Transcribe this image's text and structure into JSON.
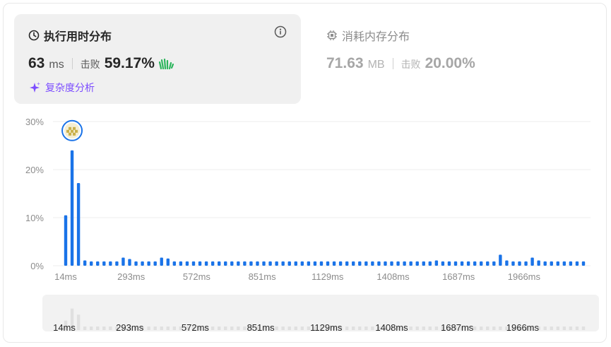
{
  "runtime": {
    "title": "执行用时分布",
    "value": "63",
    "unit": "ms",
    "beat_label": "击败",
    "beat_value": "59.17%",
    "complexity_label": "复杂度分析"
  },
  "memory": {
    "title": "消耗内存分布",
    "value": "71.63",
    "unit": "MB",
    "beat_label": "击败",
    "beat_value": "20.00%"
  },
  "colors": {
    "bar": "#1a73e8",
    "accent_purple": "#7c4dff",
    "clap_green": "#2db55d",
    "marker_ring": "#1a73e8",
    "minimap_bar": "#e0e0e0"
  },
  "icons": {
    "runtime": "clock-icon",
    "memory": "chip-icon",
    "info": "info-icon",
    "complexity": "sparkle-icon",
    "beat": "clap-hands-icon",
    "marker": "user-avatar-icon"
  },
  "chart_data": {
    "type": "bar",
    "ylabel": "",
    "xlabel": "",
    "ylim": [
      0,
      30
    ],
    "y_ticks": [
      "0%",
      "10%",
      "20%",
      "30%"
    ],
    "x_tick_labels": [
      "14ms",
      "293ms",
      "572ms",
      "851ms",
      "1129ms",
      "1408ms",
      "1687ms",
      "1966ms"
    ],
    "values": [
      10.5,
      24.0,
      17.2,
      1.1,
      0.9,
      0.9,
      0.9,
      0.9,
      0.9,
      1.7,
      1.4,
      0.9,
      0.9,
      0.9,
      0.9,
      1.7,
      1.5,
      0.9,
      0.9,
      0.9,
      0.9,
      0.9,
      0.9,
      0.9,
      0.9,
      0.9,
      0.9,
      0.9,
      0.9,
      0.9,
      0.9,
      0.9,
      0.9,
      0.9,
      0.9,
      0.9,
      0.9,
      0.9,
      0.9,
      0.9,
      0.9,
      0.9,
      0.9,
      0.9,
      0.9,
      0.9,
      0.9,
      0.9,
      0.9,
      0.9,
      0.9,
      0.9,
      0.9,
      0.9,
      0.9,
      0.9,
      0.9,
      0.9,
      1.1,
      0.9,
      0.9,
      0.9,
      0.9,
      0.9,
      0.9,
      0.9,
      0.9,
      0.9,
      2.3,
      1.1,
      0.9,
      0.9,
      0.9,
      1.7,
      1.1,
      0.9,
      0.9,
      0.9,
      0.9,
      0.9,
      0.9,
      0.9
    ],
    "highlight_index": 1,
    "grid": true,
    "minimap_tick_labels": [
      "14ms",
      "293ms",
      "572ms",
      "851ms",
      "1129ms",
      "1408ms",
      "1687ms",
      "1966ms"
    ]
  }
}
